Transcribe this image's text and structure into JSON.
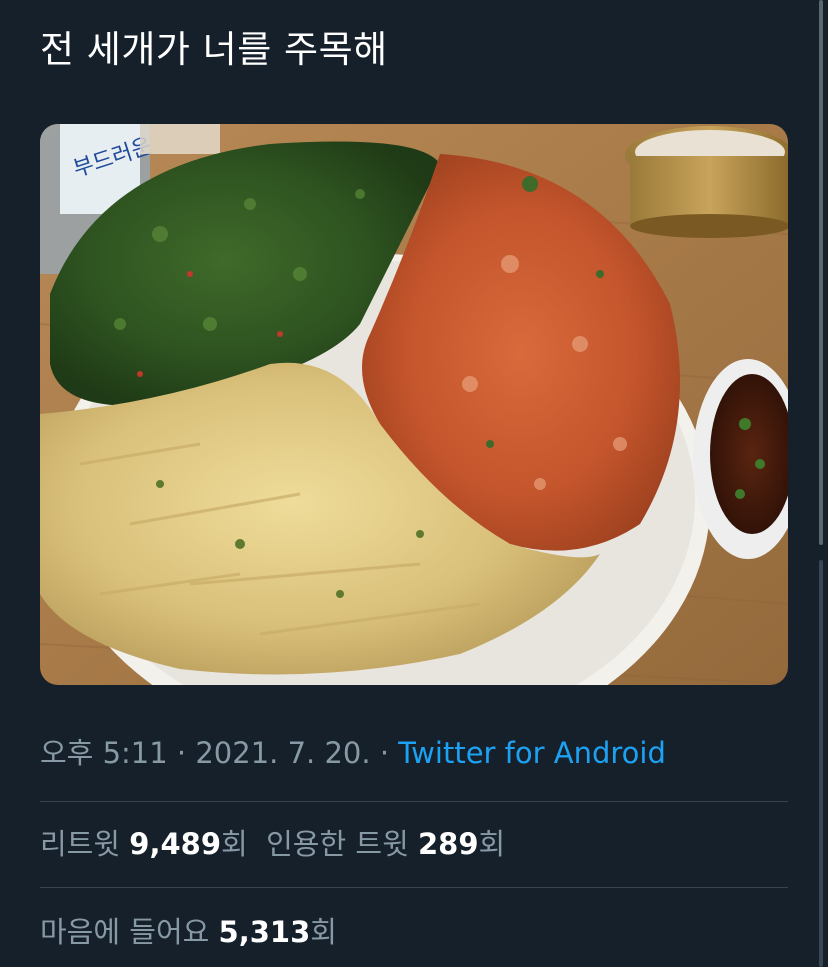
{
  "tweet": {
    "text": "전 세개가 너를 주목해",
    "media_alt_icon": "pancake-photo-image"
  },
  "meta": {
    "time": "오후 5:11",
    "separator1": " · ",
    "date": "2021. 7. 20.",
    "separator2": " · ",
    "source": "Twitter for Android"
  },
  "stats": {
    "retweets_label": "리트윗",
    "retweets_count": "9,489",
    "retweets_unit": "회",
    "quotes_label": "인용한 트윗",
    "quotes_count": "289",
    "quotes_unit": "회",
    "likes_label": "마음에 들어요",
    "likes_count": "5,313",
    "likes_unit": "회"
  },
  "colors": {
    "background": "#15202b",
    "text_primary": "#ffffff",
    "text_secondary": "#8899a6",
    "accent": "#1da1f2",
    "divider": "#38444d"
  }
}
